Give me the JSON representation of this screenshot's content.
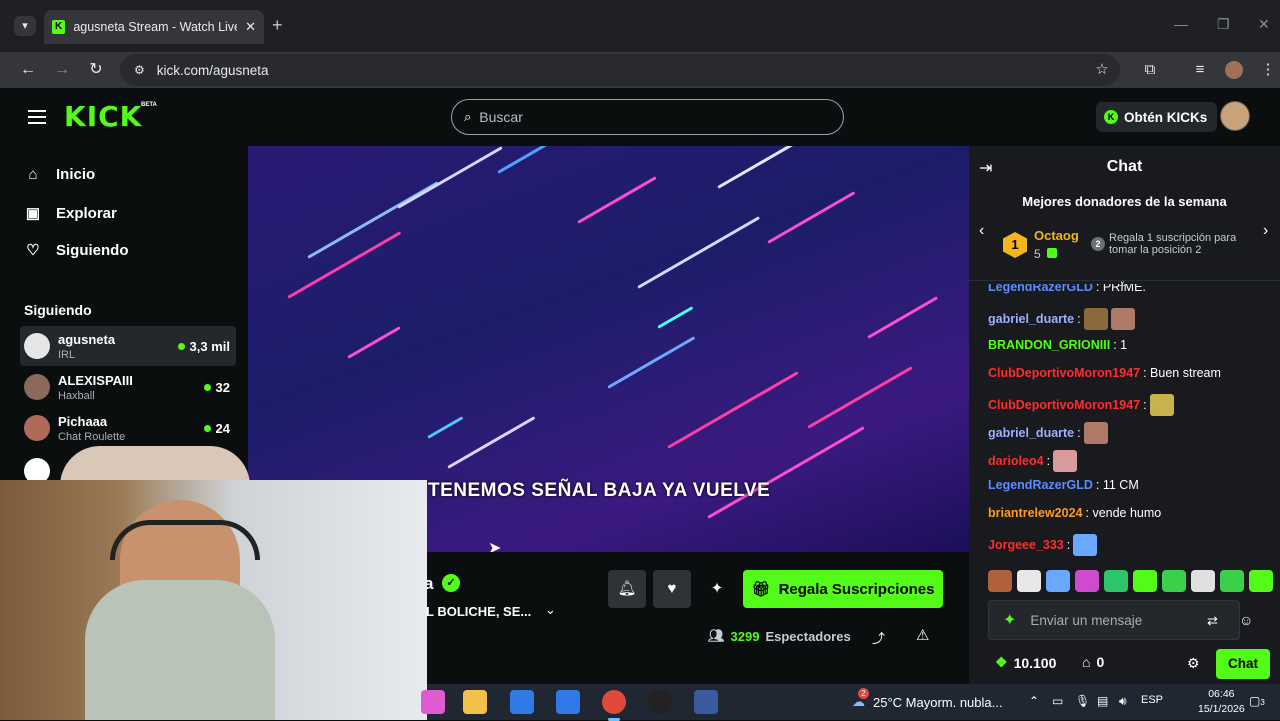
{
  "browser": {
    "tab_title": "agusneta Stream - Watch Live o",
    "url": "kick.com/agusneta"
  },
  "header": {
    "logo": "KICK",
    "beta": "BETA",
    "search_placeholder": "Buscar",
    "get_kicks": "Obtén KICKs"
  },
  "sidebar": {
    "nav": [
      {
        "label": "Inicio",
        "icon": "home-icon"
      },
      {
        "label": "Explorar",
        "icon": "compass-icon"
      },
      {
        "label": "Siguiendo",
        "icon": "heart-icon"
      }
    ],
    "following_heading": "Siguiendo",
    "following": [
      {
        "name": "agusneta",
        "category": "IRL",
        "viewers": "3,3 mil"
      },
      {
        "name": "ALEXISPAIII",
        "category": "Haxball",
        "viewers": "32"
      },
      {
        "name": "Pichaaa",
        "category": "Chat Roulette",
        "viewers": "24"
      }
    ]
  },
  "video": {
    "caption": "TENEMOS SEÑAL BAJA YA VUELVE"
  },
  "stream": {
    "name_fragment": "a",
    "title_fragment": "L BOLICHE, SE...",
    "gift_button": "Regala Suscripciones",
    "viewers": "3299",
    "viewers_label": "Espectadores"
  },
  "chat": {
    "title": "Chat",
    "donors_title": "Mejores donadores de la semana",
    "top_donor": {
      "rank": "1",
      "name": "Octaog",
      "count": "5"
    },
    "position2_rank": "2",
    "position2_text": "Regala 1 suscripción para tomar la posición 2",
    "messages": [
      {
        "user": "LegendRazerGLD",
        "color": "#5b8cff",
        "text": ": PRIME."
      },
      {
        "user": "gabriel_duarte",
        "color": "#9db0ff",
        "text": ":"
      },
      {
        "user": "BRANDON_GRIONIII",
        "color": "#53fc18",
        "text": ": 1"
      },
      {
        "user": "ClubDeportivoMoron1947",
        "color": "#ff2d2d",
        "text": ": Buen stream"
      },
      {
        "user": "ClubDeportivoMoron1947",
        "color": "#ff2d2d",
        "text": ":"
      },
      {
        "user": "gabriel_duarte",
        "color": "#9db0ff",
        "text": ":"
      },
      {
        "user": "darioleo4",
        "color": "#ff2d2d",
        "text": ":"
      },
      {
        "user": "LegendRazerGLD",
        "color": "#5b8cff",
        "text": ": 11 CM"
      },
      {
        "user": "briantrelew2024",
        "color": "#ff9a1f",
        "text": ": vende humo"
      },
      {
        "user": "Jorgeee_333",
        "color": "#ff2d2d",
        "text": ":"
      }
    ],
    "input_placeholder": "Enviar un mensaje",
    "kicks_balance": "10.100",
    "subs_count": "0",
    "chat_button": "Chat"
  },
  "taskbar": {
    "weather": "25°C  Mayorm. nubla...",
    "weather_badge": "2",
    "lang": "ESP",
    "time": "06:46",
    "date": "15/1/2026",
    "notifications": "3"
  },
  "colors": {
    "accent": "#53fc18",
    "background": "#0b0e0f",
    "chat_bg": "#181a1d"
  }
}
